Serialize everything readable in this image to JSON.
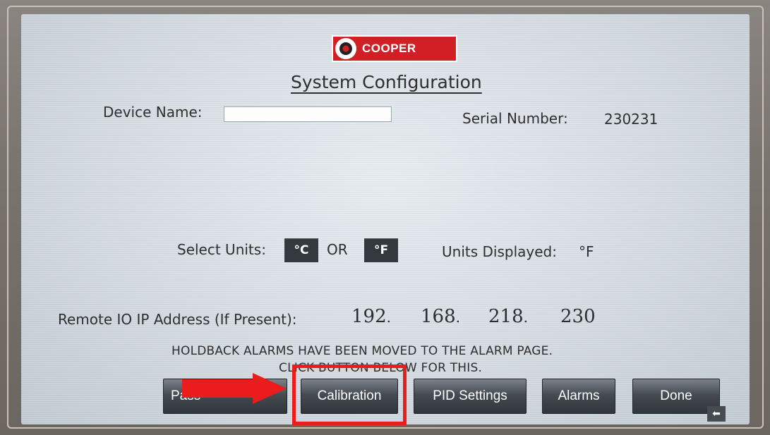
{
  "logo": {
    "text": "COOPER"
  },
  "title": "System Configuration",
  "device": {
    "label": "Device Name:",
    "value": ""
  },
  "serial": {
    "label": "Serial Number:",
    "value": "230231"
  },
  "units": {
    "select_label": "Select Units:",
    "celsius": "°C",
    "or": "OR",
    "fahrenheit": "°F",
    "displayed_label": "Units Displayed:",
    "displayed_value": "°F"
  },
  "ip": {
    "label": "Remote IO IP Address (If Present):",
    "octets": [
      "192",
      "168",
      "218",
      "230"
    ],
    "separator": "."
  },
  "notice": {
    "line1": "HOLDBACK ALARMS HAVE BEEN MOVED TO THE ALARM PAGE.",
    "line2": "CLICK BUTTON BELOW FOR THIS."
  },
  "buttons": {
    "password": "Pass",
    "calibration": "Calibration",
    "pid": "PID Settings",
    "alarms": "Alarms",
    "done": "Done",
    "back": "⬅"
  },
  "colors": {
    "annotation_red": "#ea1c1c",
    "button_dark": "#30353b",
    "logo_red": "#d11f26"
  }
}
